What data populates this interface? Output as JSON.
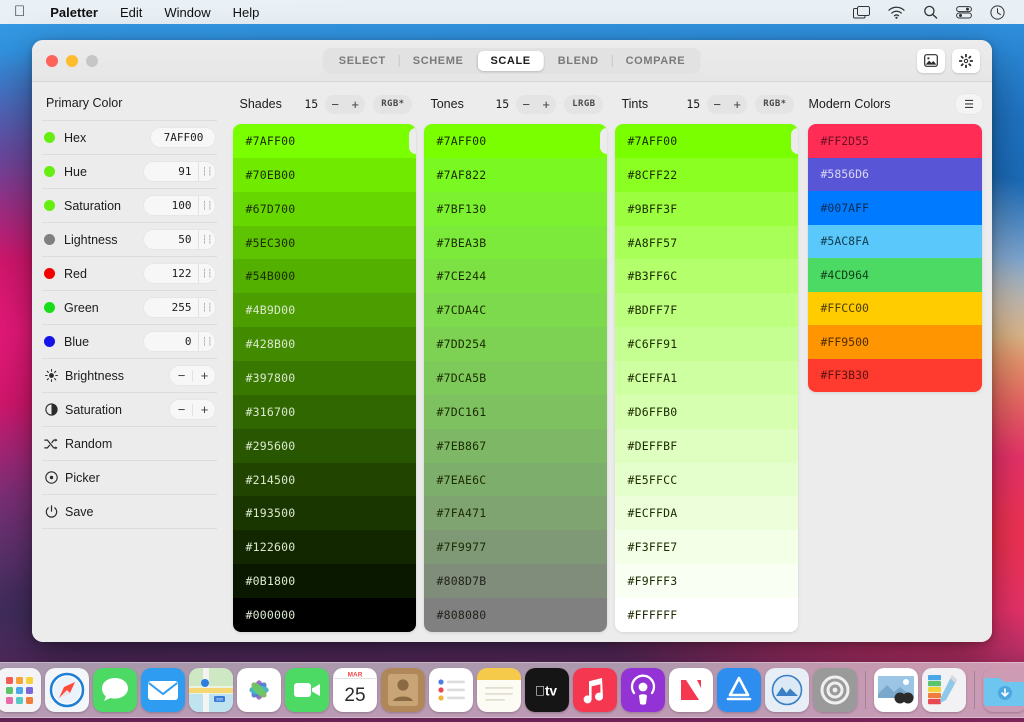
{
  "menubar": {
    "apple_icon": "apple-logo-icon",
    "items": [
      {
        "label": "Paletter",
        "bold": true
      },
      {
        "label": "Edit",
        "bold": false
      },
      {
        "label": "Window",
        "bold": false
      },
      {
        "label": "Help",
        "bold": false
      }
    ],
    "status_icons": [
      "screen-mirroring-icon",
      "wifi-icon",
      "search-icon",
      "control-center-icon",
      "clock-icon"
    ]
  },
  "window": {
    "traffic_lights": [
      "close-button",
      "minimize-button",
      "zoom-button"
    ],
    "tabs": [
      {
        "label": "SELECT",
        "active": false
      },
      {
        "label": "SCHEME",
        "active": false
      },
      {
        "label": "SCALE",
        "active": true
      },
      {
        "label": "BLEND",
        "active": false
      },
      {
        "label": "COMPARE",
        "active": false
      }
    ],
    "title_buttons": [
      "image-export-icon",
      "gear-icon"
    ]
  },
  "sidebar": {
    "title": "Primary Color",
    "rows": [
      {
        "label": "Hex",
        "value": "7AFF00",
        "dot": "#66ee11",
        "kind": "hex"
      },
      {
        "label": "Hue",
        "value": "91",
        "dot": "#66ee11",
        "kind": "value"
      },
      {
        "label": "Saturation",
        "value": "100",
        "dot": "#66ee11",
        "kind": "value"
      },
      {
        "label": "Lightness",
        "value": "50",
        "dot": "#808080",
        "kind": "value"
      },
      {
        "label": "Red",
        "value": "122",
        "dot": "#f40000",
        "kind": "value"
      },
      {
        "label": "Green",
        "value": "255",
        "dot": "#18dd18",
        "kind": "value"
      },
      {
        "label": "Blue",
        "value": "0",
        "dot": "#1414e6",
        "kind": "value"
      },
      {
        "label": "Brightness",
        "icon": "brightness-icon",
        "kind": "stepper",
        "minus": "−",
        "plus": "+"
      },
      {
        "label": "Saturation",
        "icon": "contrast-icon",
        "kind": "stepper",
        "minus": "−",
        "plus": "+"
      },
      {
        "label": "Random",
        "icon": "shuffle-icon",
        "kind": "action"
      },
      {
        "label": "Picker",
        "icon": "picker-target-icon",
        "kind": "action"
      },
      {
        "label": "Save",
        "icon": "power-save-icon",
        "kind": "action"
      }
    ]
  },
  "columns": [
    {
      "name": "Shades",
      "count": "15",
      "minus": "−",
      "plus": "+",
      "mode": "RGB*",
      "swatches": [
        {
          "hex": "#7AFF00",
          "text": "#1c2b00",
          "selected": true
        },
        {
          "hex": "#70EB00",
          "text": "#1c2b00",
          "selected": false
        },
        {
          "hex": "#67D700",
          "text": "#1c2b00",
          "selected": false
        },
        {
          "hex": "#5EC300",
          "text": "#1c2b00",
          "selected": false
        },
        {
          "hex": "#54B000",
          "text": "#1c2b00",
          "selected": false
        },
        {
          "hex": "#4B9D00",
          "text": "#dbe8cf",
          "selected": false
        },
        {
          "hex": "#428B00",
          "text": "#dbe8cf",
          "selected": false
        },
        {
          "hex": "#397800",
          "text": "#dbe8cf",
          "selected": false
        },
        {
          "hex": "#316700",
          "text": "#dbe8cf",
          "selected": false
        },
        {
          "hex": "#295600",
          "text": "#dbe8cf",
          "selected": false
        },
        {
          "hex": "#214500",
          "text": "#dbe8cf",
          "selected": false
        },
        {
          "hex": "#193500",
          "text": "#dbe8cf",
          "selected": false
        },
        {
          "hex": "#122600",
          "text": "#dbe8cf",
          "selected": false
        },
        {
          "hex": "#0B1800",
          "text": "#dbe8cf",
          "selected": false
        },
        {
          "hex": "#000000",
          "text": "#dbe8cf",
          "selected": false
        }
      ]
    },
    {
      "name": "Tones",
      "count": "15",
      "minus": "−",
      "plus": "+",
      "mode": "LRGB",
      "swatches": [
        {
          "hex": "#7AFF00",
          "text": "#1c2b00",
          "selected": true
        },
        {
          "hex": "#7AF822",
          "text": "#1c2b00",
          "selected": false
        },
        {
          "hex": "#7BF130",
          "text": "#1c2b00",
          "selected": false
        },
        {
          "hex": "#7BEA3B",
          "text": "#1c2b00",
          "selected": false
        },
        {
          "hex": "#7CE244",
          "text": "#1c2b00",
          "selected": false
        },
        {
          "hex": "#7CDA4C",
          "text": "#1c2b00",
          "selected": false
        },
        {
          "hex": "#7DD254",
          "text": "#1c2b00",
          "selected": false
        },
        {
          "hex": "#7DCA5B",
          "text": "#1c2b00",
          "selected": false
        },
        {
          "hex": "#7DC161",
          "text": "#1c2b00",
          "selected": false
        },
        {
          "hex": "#7EB867",
          "text": "#1c2b00",
          "selected": false
        },
        {
          "hex": "#7EAE6C",
          "text": "#1c2b00",
          "selected": false
        },
        {
          "hex": "#7FA471",
          "text": "#1c2b00",
          "selected": false
        },
        {
          "hex": "#7F9977",
          "text": "#1c2b00",
          "selected": false
        },
        {
          "hex": "#808D7B",
          "text": "#23231c",
          "selected": false
        },
        {
          "hex": "#808080",
          "text": "#23231c",
          "selected": false
        }
      ]
    },
    {
      "name": "Tints",
      "count": "15",
      "minus": "−",
      "plus": "+",
      "mode": "RGB*",
      "swatches": [
        {
          "hex": "#7AFF00",
          "text": "#1c2b00",
          "selected": true
        },
        {
          "hex": "#8CFF22",
          "text": "#1c2b00",
          "selected": false
        },
        {
          "hex": "#9BFF3F",
          "text": "#1c2b00",
          "selected": false
        },
        {
          "hex": "#A8FF57",
          "text": "#1c2b00",
          "selected": false
        },
        {
          "hex": "#B3FF6C",
          "text": "#1c2b00",
          "selected": false
        },
        {
          "hex": "#BDFF7F",
          "text": "#1c2b00",
          "selected": false
        },
        {
          "hex": "#C6FF91",
          "text": "#1c2b00",
          "selected": false
        },
        {
          "hex": "#CEFFA1",
          "text": "#1c2b00",
          "selected": false
        },
        {
          "hex": "#D6FFB0",
          "text": "#1c2b00",
          "selected": false
        },
        {
          "hex": "#DEFFBF",
          "text": "#1c2b00",
          "selected": false
        },
        {
          "hex": "#E5FFCC",
          "text": "#1c2b00",
          "selected": false
        },
        {
          "hex": "#ECFFDA",
          "text": "#1c2b00",
          "selected": false
        },
        {
          "hex": "#F3FFE7",
          "text": "#1c2b00",
          "selected": false
        },
        {
          "hex": "#F9FFF3",
          "text": "#1c2b00",
          "selected": false
        },
        {
          "hex": "#FFFFFF",
          "text": "#1c2b00",
          "selected": false
        }
      ]
    }
  ],
  "modern": {
    "title": "Modern Colors",
    "menu_icon": "☰",
    "swatches": [
      {
        "hex": "#FF2D55",
        "text": "#6b0f20"
      },
      {
        "hex": "#5856D6",
        "text": "#d7d6f2"
      },
      {
        "hex": "#007AFF",
        "text": "#0b2d52"
      },
      {
        "hex": "#5AC8FA",
        "text": "#0f3c50"
      },
      {
        "hex": "#4CD964",
        "text": "#10401a"
      },
      {
        "hex": "#FFCC00",
        "text": "#4d3d00"
      },
      {
        "hex": "#FF9500",
        "text": "#4d2c00"
      },
      {
        "hex": "#FF3B30",
        "text": "#5c120d"
      }
    ]
  },
  "dock": {
    "items": [
      {
        "name": "finder",
        "running": true
      },
      {
        "name": "launchpad",
        "running": false
      },
      {
        "name": "safari",
        "running": false
      },
      {
        "name": "messages",
        "running": false
      },
      {
        "name": "mail",
        "running": false
      },
      {
        "name": "maps",
        "running": false
      },
      {
        "name": "photos",
        "running": false
      },
      {
        "name": "facetime",
        "running": false
      },
      {
        "name": "calendar",
        "running": false,
        "month": "MAR",
        "day": "25"
      },
      {
        "name": "contacts",
        "running": false
      },
      {
        "name": "reminders",
        "running": false
      },
      {
        "name": "notes",
        "running": false
      },
      {
        "name": "appletv",
        "running": false
      },
      {
        "name": "music",
        "running": false
      },
      {
        "name": "podcasts",
        "running": false
      },
      {
        "name": "news",
        "running": false
      },
      {
        "name": "appstore",
        "running": false
      },
      {
        "name": "appleapps",
        "running": false
      },
      {
        "name": "systempreferences",
        "running": false
      },
      {
        "name": "separator-1",
        "running": false
      },
      {
        "name": "preview",
        "running": false
      },
      {
        "name": "paletter",
        "running": true
      },
      {
        "name": "separator-2",
        "running": false
      },
      {
        "name": "downloads-folder",
        "running": false
      },
      {
        "name": "trash",
        "running": false
      }
    ]
  }
}
